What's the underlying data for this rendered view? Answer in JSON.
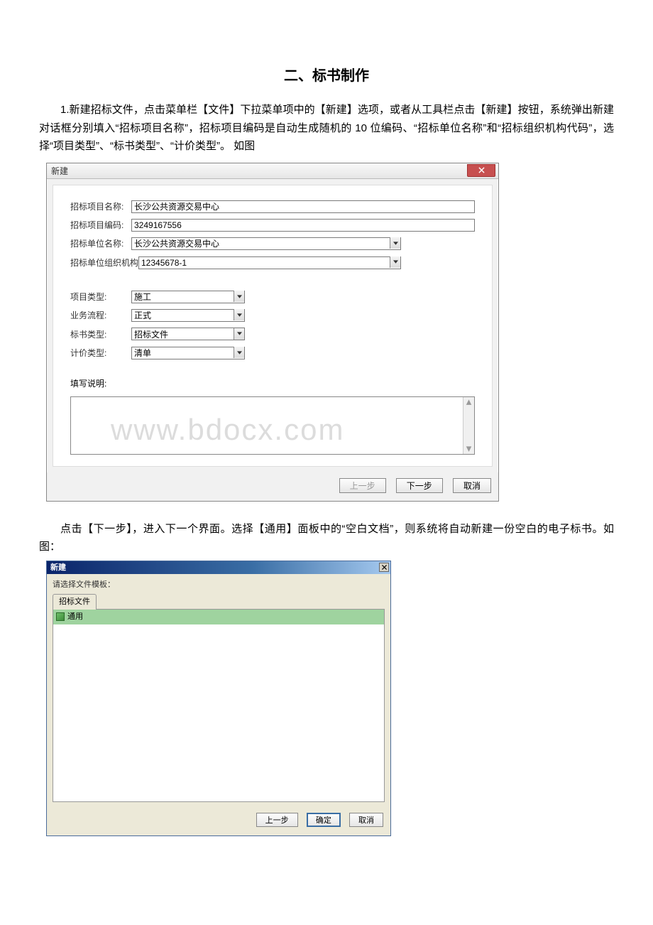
{
  "heading": "二、标书制作",
  "paragraph1": "1.新建招标文件，点击菜单栏【文件】下拉菜单项中的【新建】选项，或者从工具栏点击【新建】按钮，系统弹出新建对话框分别填入“招标项目名称”，招标项目编码是自动生成随机的 10 位编码、“招标单位名称”和“招标组织机构代码”，选择“项目类型”、“标书类型”、“计价类型”。 如图",
  "dialog1": {
    "title": "新建",
    "labels": {
      "projectName": "招标项目名称:",
      "projectCode": "招标项目编码:",
      "orgName": "招标单位名称:",
      "orgCode": "招标单位组织机构",
      "projType": "项目类型:",
      "bizFlow": "业务流程:",
      "docType": "标书类型:",
      "priceType": "计价类型:",
      "notes": "填写说明:"
    },
    "values": {
      "projectName": "长沙公共资源交易中心",
      "projectCode": "3249167556",
      "orgName": "长沙公共资源交易中心",
      "orgCode": "12345678-1",
      "projType": "施工",
      "bizFlow": "正式",
      "docType": "招标文件",
      "priceType": "清单"
    },
    "buttons": {
      "prev": "上一步",
      "next": "下一步",
      "cancel": "取消"
    },
    "watermark": "www.bdocx.com"
  },
  "paragraph2": "点击【下一步】，进入下一个界面。选择【通用】面板中的“空白文档”，则系统将自动新建一份空白的电子标书。如图：",
  "dialog2": {
    "title": "新建",
    "label": "请选择文件模板：",
    "tab": "招标文件",
    "item": "通用",
    "buttons": {
      "prev": "上一步",
      "ok": "确定",
      "cancel": "取消"
    }
  }
}
